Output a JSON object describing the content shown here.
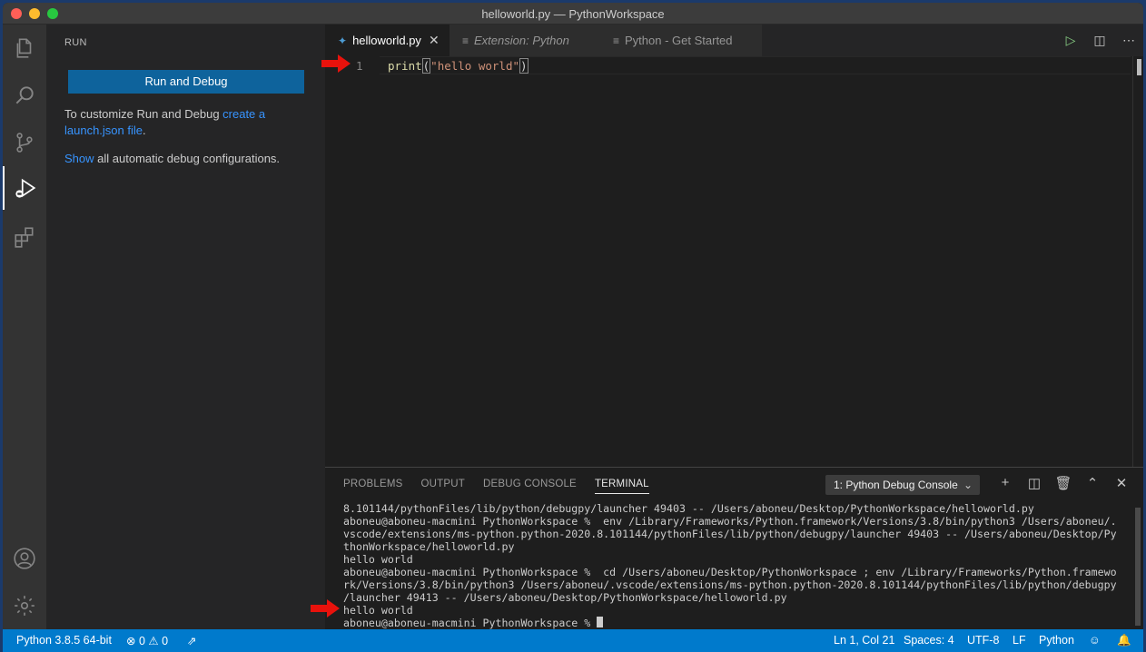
{
  "window": {
    "title": "helloworld.py — PythonWorkspace"
  },
  "sidebar": {
    "title": "RUN",
    "run_button": "Run and Debug",
    "customize_prefix": "To customize Run and Debug ",
    "customize_link": "create a launch.json file",
    "customize_suffix": ".",
    "show_link": "Show",
    "show_suffix": " all automatic debug configurations."
  },
  "tabs": [
    {
      "label": "helloworld.py",
      "icon": "python-file-icon",
      "active": true
    },
    {
      "label": "Extension: Python",
      "icon": "preview-icon",
      "active": false
    },
    {
      "label": "Python - Get Started",
      "icon": "preview-icon",
      "active": false
    }
  ],
  "editor": {
    "line_number": "1",
    "code_fn": "print",
    "code_open": "(",
    "code_str": "\"hello world\"",
    "code_close": ")"
  },
  "panel": {
    "tabs": [
      "PROBLEMS",
      "OUTPUT",
      "DEBUG CONSOLE",
      "TERMINAL"
    ],
    "active_tab": "TERMINAL",
    "terminal_select": "1: Python Debug Console",
    "terminal_lines": [
      "8.101144/pythonFiles/lib/python/debugpy/launcher 49403 -- /Users/aboneu/Desktop/PythonWorkspace/helloworld.py",
      "aboneu@aboneu-macmini PythonWorkspace %  env /Library/Frameworks/Python.framework/Versions/3.8/bin/python3 /Users/aboneu/.",
      "vscode/extensions/ms-python.python-2020.8.101144/pythonFiles/lib/python/debugpy/launcher 49403 -- /Users/aboneu/Desktop/Py",
      "thonWorkspace/helloworld.py",
      "hello world",
      "aboneu@aboneu-macmini PythonWorkspace %  cd /Users/aboneu/Desktop/PythonWorkspace ; env /Library/Frameworks/Python.framewo",
      "rk/Versions/3.8/bin/python3 /Users/aboneu/.vscode/extensions/ms-python.python-2020.8.101144/pythonFiles/lib/python/debugpy",
      "/launcher 49413 -- /Users/aboneu/Desktop/PythonWorkspace/helloworld.py",
      "hello world"
    ],
    "prompt": "aboneu@aboneu-macmini PythonWorkspace % "
  },
  "statusbar": {
    "interpreter": "Python 3.8.5 64-bit",
    "errors": "0",
    "warnings": "0",
    "position": "Ln 1, Col 21",
    "spaces": "Spaces: 4",
    "encoding": "UTF-8",
    "eol": "LF",
    "language": "Python"
  },
  "colors": {
    "accent": "#007acc",
    "button": "#0e639c",
    "annotation_arrow": "#e8120c"
  }
}
